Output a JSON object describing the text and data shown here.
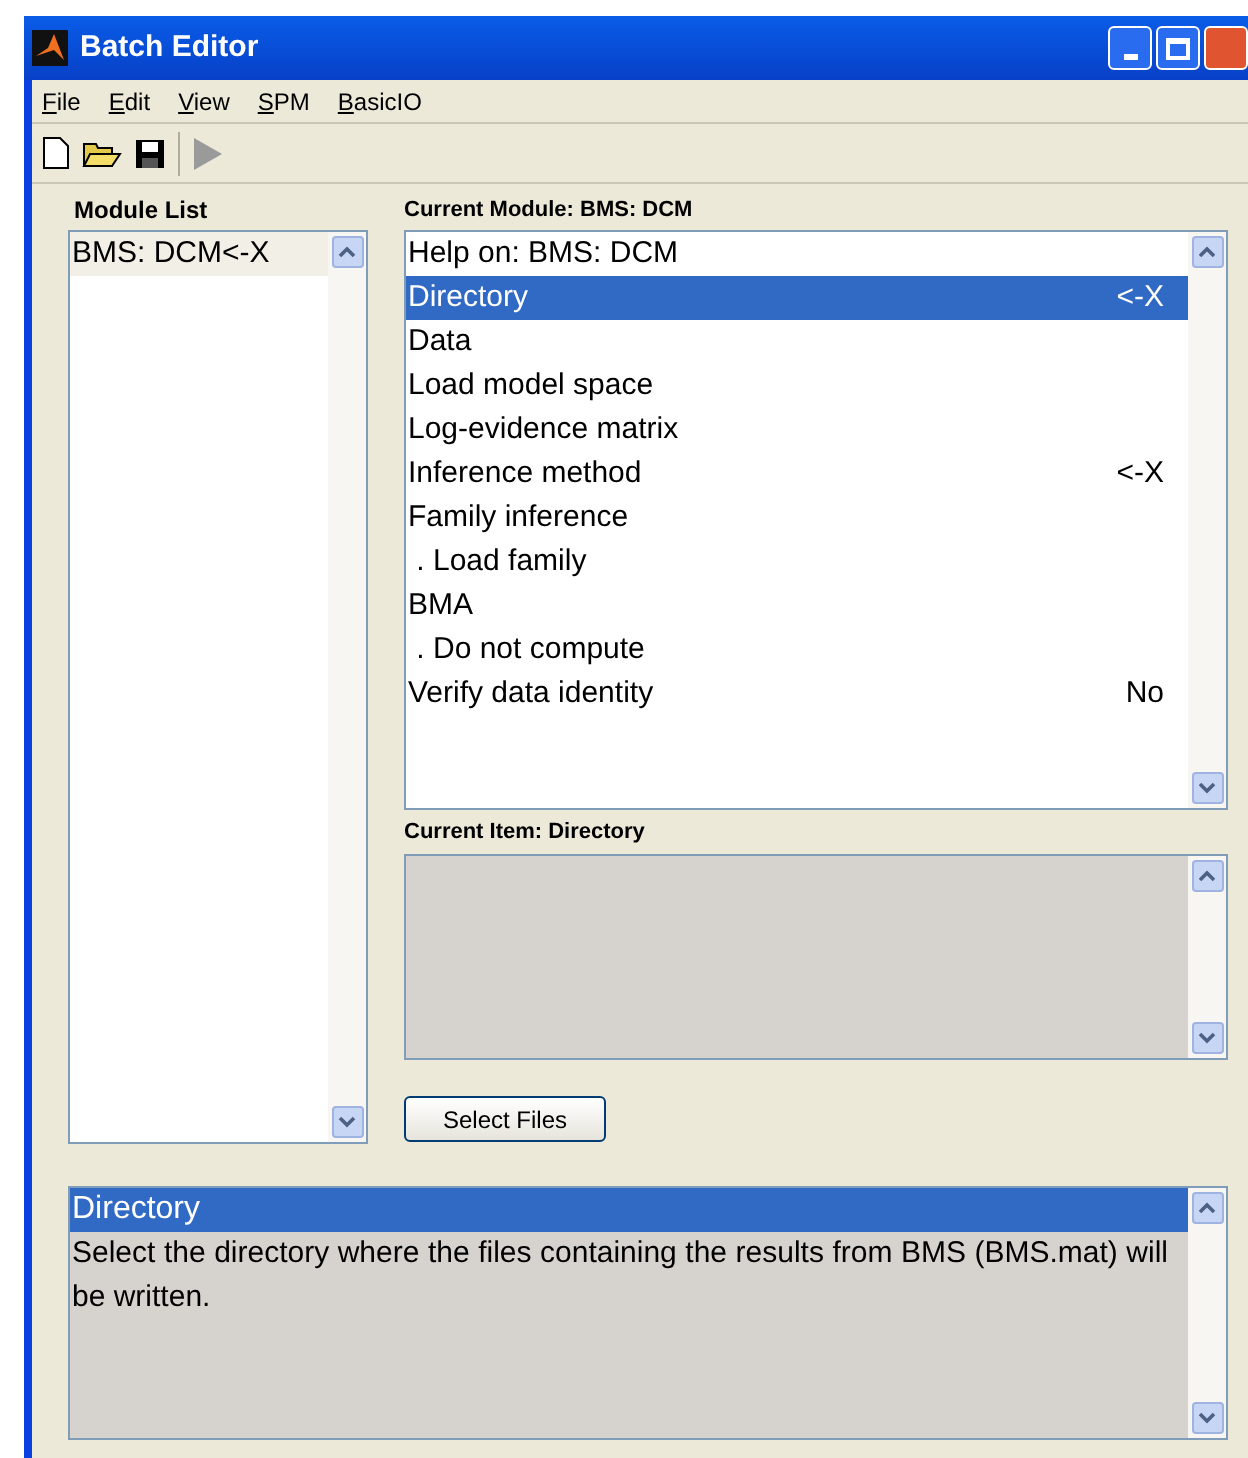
{
  "window": {
    "title": "Batch Editor"
  },
  "menu": [
    "File",
    "Edit",
    "View",
    "SPM",
    "BasicIO"
  ],
  "toolbar": [
    {
      "kind": "new",
      "disabled": false
    },
    {
      "kind": "open",
      "disabled": false
    },
    {
      "kind": "save",
      "disabled": false
    },
    {
      "kind": "run",
      "disabled": true
    }
  ],
  "module_list": {
    "label": "Module List",
    "items": [
      {
        "name": "BMS: DCM<-X",
        "selected": false
      }
    ]
  },
  "current_module": {
    "label": "Current Module: BMS: DCM",
    "items": [
      {
        "name": "Help on: BMS: DCM",
        "value": "",
        "selected": false
      },
      {
        "name": "Directory",
        "value": "<-X",
        "selected": true
      },
      {
        "name": "Data",
        "value": "",
        "selected": false
      },
      {
        "name": "Load model space",
        "value": "",
        "selected": false
      },
      {
        "name": "Log-evidence matrix",
        "value": "",
        "selected": false
      },
      {
        "name": "Inference method",
        "value": "<-X",
        "selected": false
      },
      {
        "name": "Family inference",
        "value": "",
        "selected": false
      },
      {
        "name": " . Load family",
        "value": "",
        "selected": false
      },
      {
        "name": "BMA",
        "value": "",
        "selected": false
      },
      {
        "name": " . Do not compute",
        "value": "",
        "selected": false
      },
      {
        "name": "Verify data identity",
        "value": "No",
        "selected": false
      }
    ]
  },
  "current_item": {
    "label": "Current Item: Directory"
  },
  "select_button": "Select Files",
  "help": {
    "title": "Directory",
    "text": "Select the directory where the files containing the results from BMS (BMS.mat) will be written."
  }
}
